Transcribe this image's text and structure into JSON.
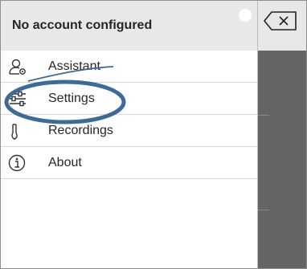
{
  "header": {
    "title": "No account configured"
  },
  "menu": {
    "items": [
      {
        "label": "Assistant",
        "icon": "assistant-user-gear-icon"
      },
      {
        "label": "Settings",
        "icon": "settings-sliders-icon"
      },
      {
        "label": "Recordings",
        "icon": "recordings-microphone-icon"
      },
      {
        "label": "About",
        "icon": "info-icon"
      }
    ]
  },
  "annotation": {
    "color": "#3e6a97",
    "shape": "ellipse",
    "target": "Settings"
  },
  "colors": {
    "header_bg": "#e8e8e8",
    "backdrop": "#656565",
    "text": "#262626"
  }
}
